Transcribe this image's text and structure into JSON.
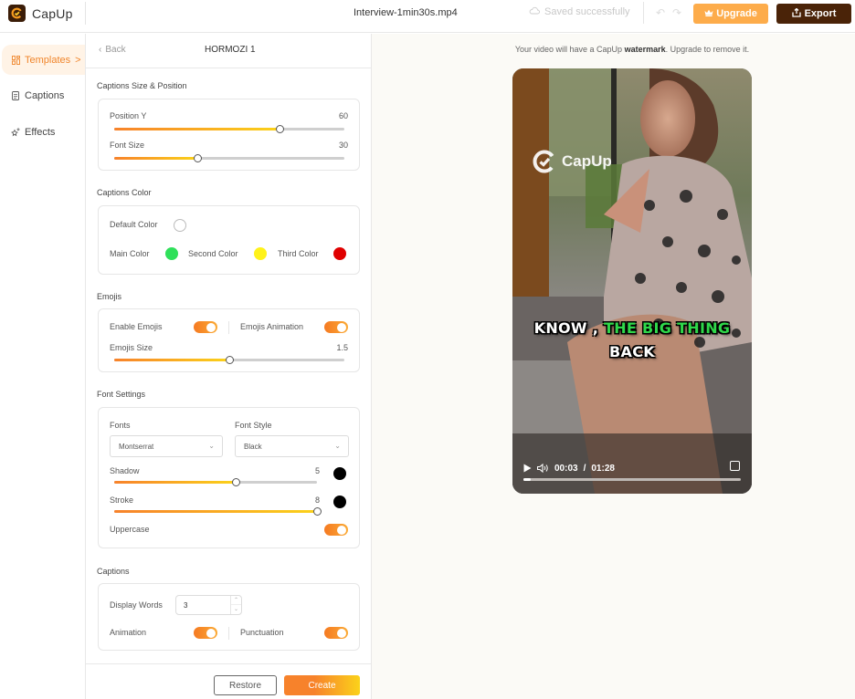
{
  "header": {
    "app_name": "CapUp",
    "filename": "Interview-1min30s.mp4",
    "save_status": "Saved successfully",
    "upgrade_label": "Upgrade",
    "export_label": "Export",
    "brand_color": "#fdac4b",
    "export_color": "#4a2308"
  },
  "nav": {
    "items": [
      {
        "label": "Templates",
        "icon": "templates-icon",
        "active": true,
        "suffix": ">"
      },
      {
        "label": "Captions",
        "icon": "captions-icon",
        "active": false
      },
      {
        "label": "Effects",
        "icon": "effects-icon",
        "active": false
      }
    ]
  },
  "panel": {
    "back_label": "Back",
    "title": "HORMOZI 1",
    "size_position": {
      "section_label": "Captions Size & Position",
      "position_y": {
        "label": "Position Y",
        "value": "60",
        "fraction": 0.72
      },
      "font_size": {
        "label": "Font Size",
        "value": "30",
        "fraction": 0.36
      }
    },
    "colors": {
      "section_label": "Captions Color",
      "default": {
        "label": "Default Color",
        "color": "#ffffff"
      },
      "main": {
        "label": "Main Color",
        "color": "#2fe05a"
      },
      "second": {
        "label": "Second Color",
        "color": "#fff21a"
      },
      "third": {
        "label": "Third Color",
        "color": "#e00000"
      }
    },
    "emojis": {
      "section_label": "Emojis",
      "enable_label": "Enable Emojis",
      "enable_on": true,
      "animation_label": "Emojis Animation",
      "animation_on": true,
      "size": {
        "label": "Emojis Size",
        "value": "1.5",
        "fraction": 0.5
      }
    },
    "font": {
      "section_label": "Font Settings",
      "fonts_label": "Fonts",
      "font_value": "Montserrat",
      "style_label": "Font Style",
      "style_value": "Black",
      "shadow": {
        "label": "Shadow",
        "value": "5",
        "fraction": 0.6,
        "color": "#000000"
      },
      "stroke": {
        "label": "Stroke",
        "value": "8",
        "fraction": 1.0,
        "color": "#000000"
      },
      "uppercase_label": "Uppercase",
      "uppercase_on": true
    },
    "captions": {
      "section_label": "Captions",
      "display_words_label": "Display Words",
      "display_words_value": "3",
      "animation_label": "Animation",
      "animation_on": true,
      "punctuation_label": "Punctuation",
      "punctuation_on": true
    },
    "restore_label": "Restore",
    "create_label": "Create"
  },
  "preview": {
    "notice_prefix": "Your video will have a CapUp ",
    "notice_bold": "watermark",
    "notice_suffix": ". Upgrade to remove it.",
    "watermark_text": "CapUp",
    "caption_line1_white": "KNOW ,",
    "caption_line1_highlight": "THE BIG THING",
    "caption_line2": "BACK",
    "highlight_color": "#2fd84a",
    "current_time": "00:03",
    "duration": "01:28",
    "time_separator": "/",
    "progress_fraction": 0.034
  }
}
